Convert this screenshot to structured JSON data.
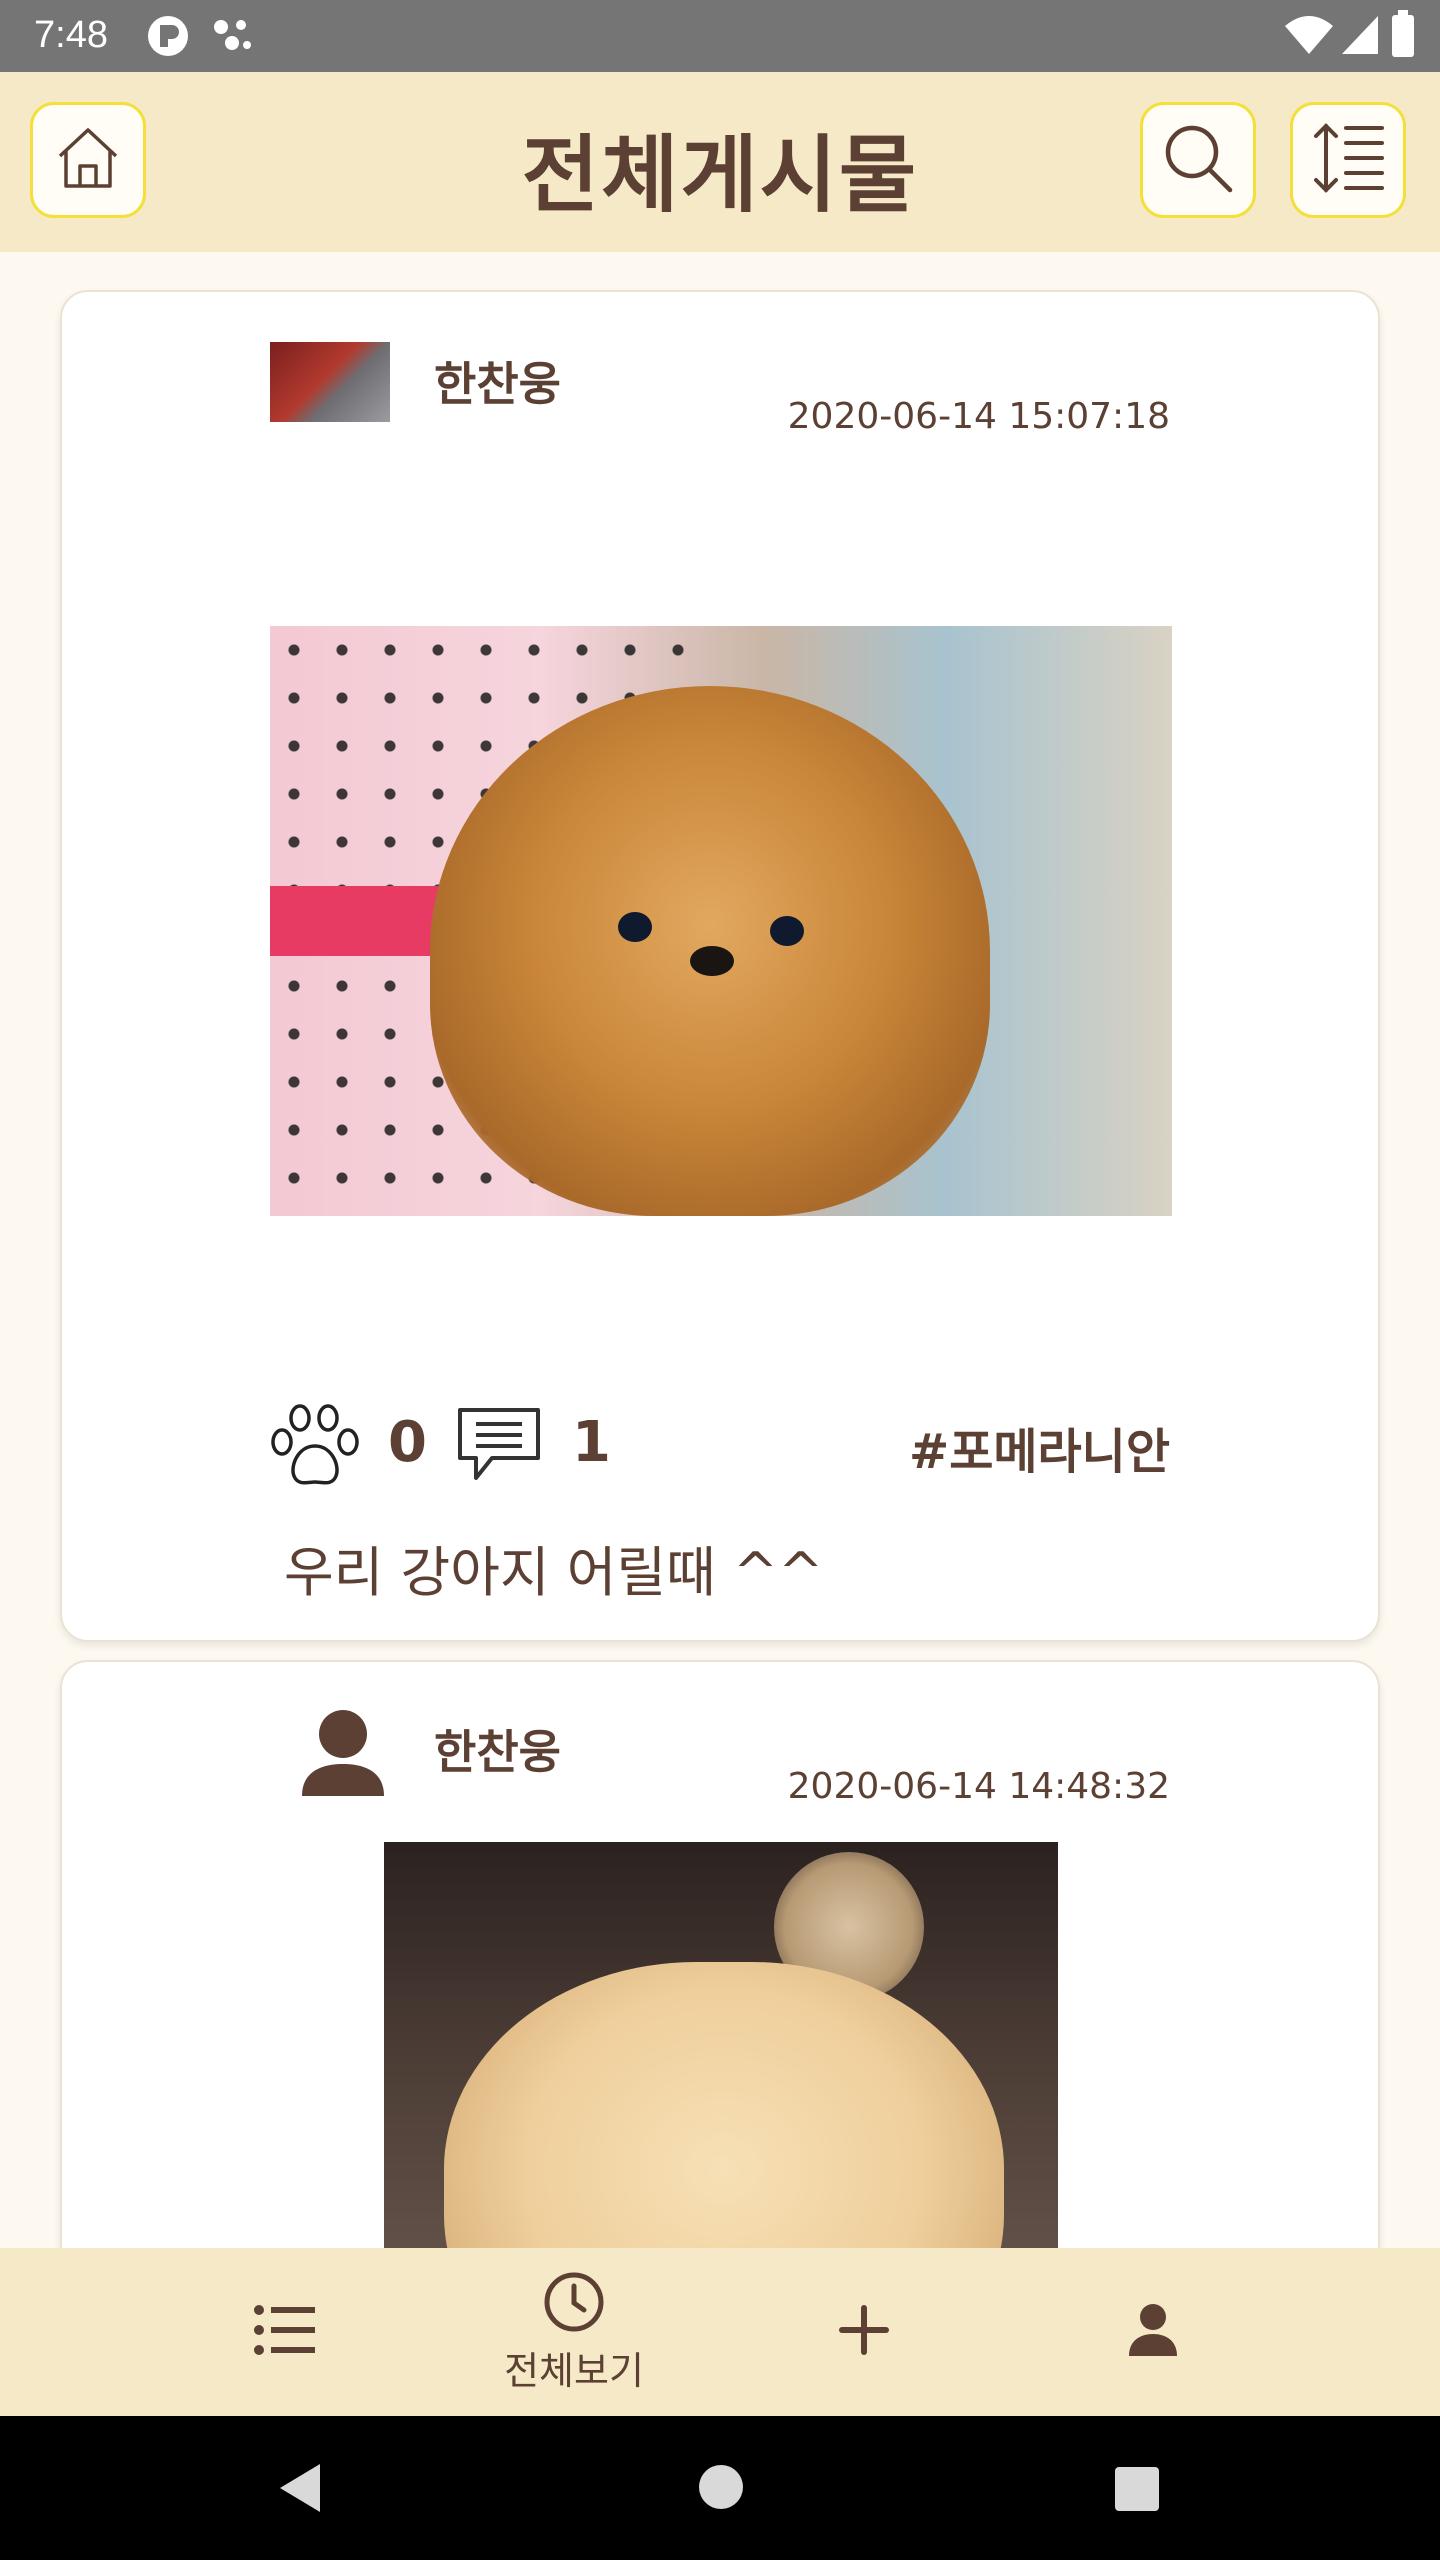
{
  "status": {
    "time": "7:48"
  },
  "header": {
    "title": "전체게시물",
    "home_icon": "home-icon",
    "search_icon": "search-icon",
    "sort_icon": "sort-icon"
  },
  "posts": [
    {
      "author": "한찬웅",
      "timestamp": "2020-06-14 15:07:18",
      "avatar": "cat-photo",
      "image": "pomeranian-puppy-photo",
      "likes": "0",
      "comments": "1",
      "hashtag": "#포메라니안",
      "caption": "우리 강아지 어릴때 ^^"
    },
    {
      "author": "한찬웅",
      "timestamp": "2020-06-14 14:48:32",
      "avatar": "person-icon",
      "image": "pomeranian-back-photo"
    }
  ],
  "bottom_nav": {
    "items": [
      {
        "icon": "list-icon",
        "label": ""
      },
      {
        "icon": "clock-icon",
        "label": "전체보기"
      },
      {
        "icon": "plus-icon",
        "label": ""
      },
      {
        "icon": "person-icon",
        "label": ""
      }
    ]
  },
  "colors": {
    "accent": "#f5e9c7",
    "text": "#5b4033",
    "button_border": "#f3e03a"
  }
}
